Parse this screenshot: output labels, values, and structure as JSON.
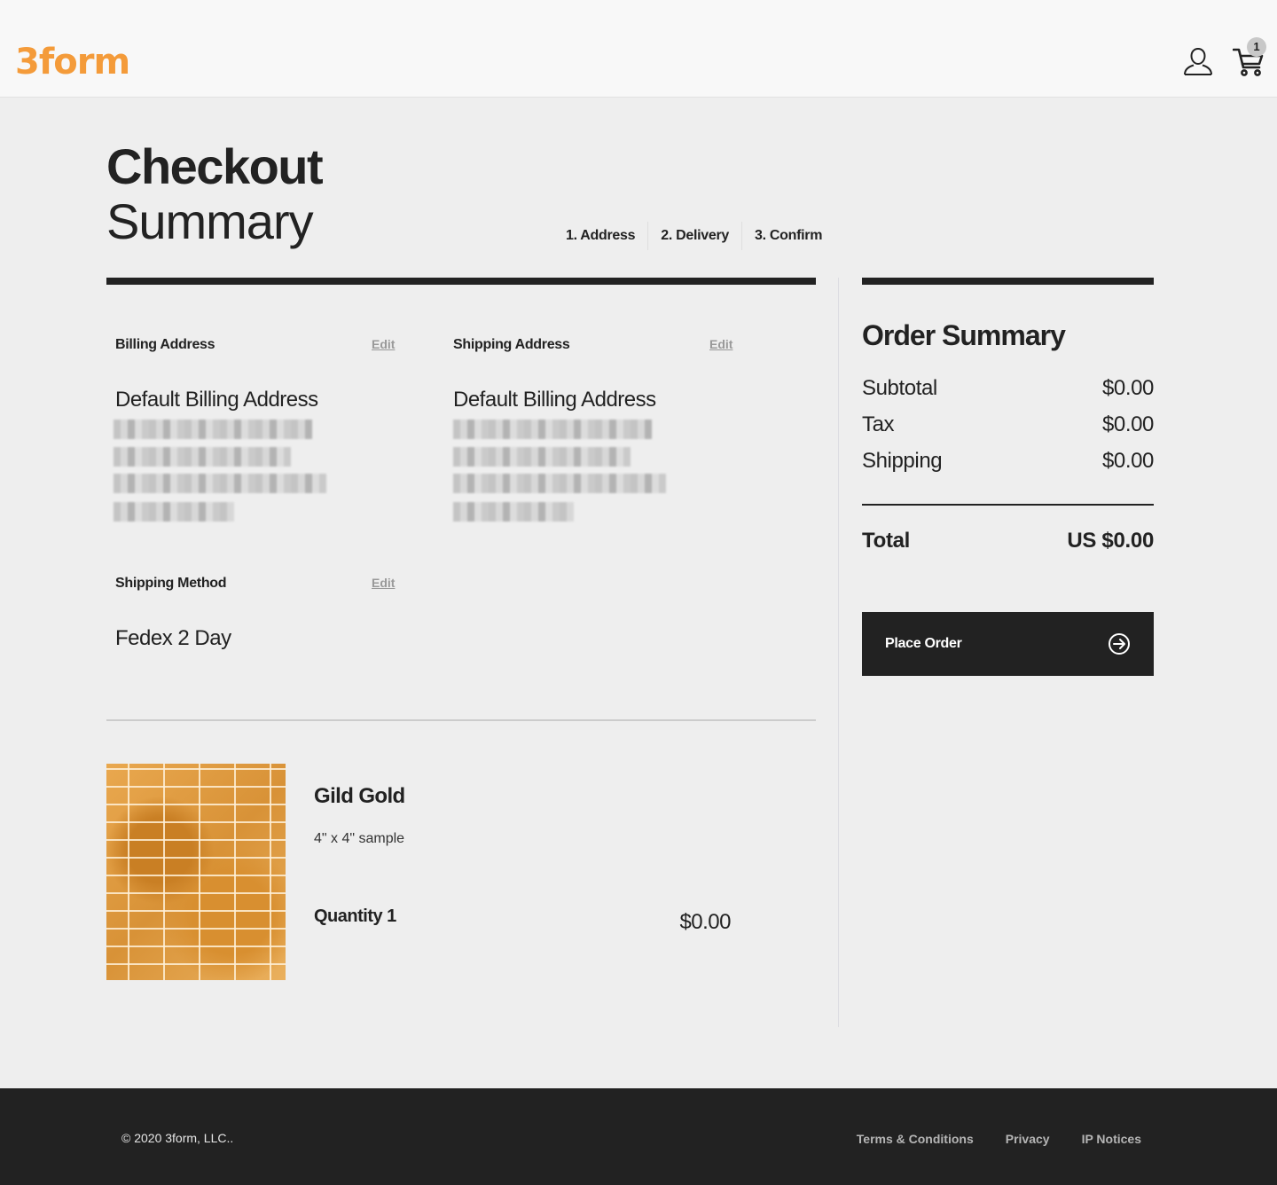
{
  "header": {
    "logo_text": "3form",
    "brand_color": "#f49b3a",
    "user_icon": "user-icon",
    "cart_icon": "cart-icon",
    "cart_count": "1"
  },
  "page": {
    "title_bold": "Checkout",
    "title_light": "Summary"
  },
  "steps": [
    {
      "label": "1. Address"
    },
    {
      "label": "2. Delivery"
    },
    {
      "label": "3. Confirm"
    }
  ],
  "billing": {
    "label": "Billing Address",
    "edit_label": "Edit",
    "name": "Default Billing Address",
    "redacted_lines": 4
  },
  "shipping": {
    "label": "Shipping Address",
    "edit_label": "Edit",
    "name": "Default Billing Address",
    "redacted_lines": 4
  },
  "shipping_method": {
    "label": "Shipping Method",
    "edit_label": "Edit",
    "value": "Fedex 2 Day"
  },
  "product": {
    "name": "Gild Gold",
    "description": "4\" x 4\" sample",
    "quantity_label": "Quantity 1",
    "price": "$0.00"
  },
  "order_summary": {
    "title": "Order Summary",
    "rows": [
      {
        "label": "Subtotal",
        "value": "$0.00"
      },
      {
        "label": "Tax",
        "value": "$0.00"
      },
      {
        "label": "Shipping",
        "value": "$0.00"
      }
    ],
    "total_label": "Total",
    "total_value": "US $0.00",
    "place_order_label": "Place Order",
    "place_order_icon": "arrow-circle-right-icon"
  },
  "footer": {
    "copyright": "© 2020 3form, LLC..",
    "links": [
      {
        "label": "Terms & Conditions"
      },
      {
        "label": "Privacy"
      },
      {
        "label": "IP Notices"
      }
    ]
  }
}
